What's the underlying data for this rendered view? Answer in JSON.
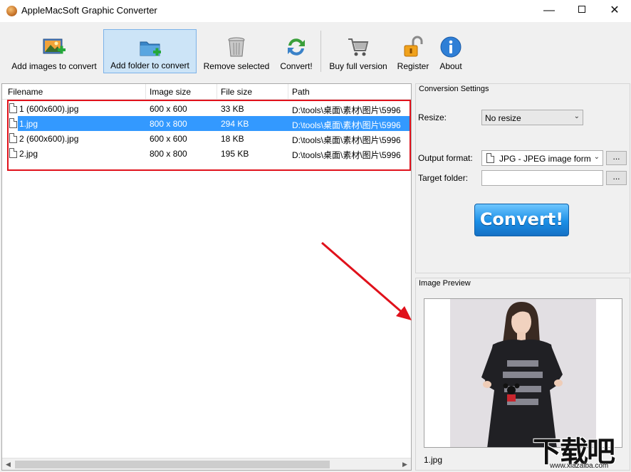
{
  "window": {
    "title": "AppleMacSoft Graphic Converter",
    "minimize": "—",
    "close": "✕"
  },
  "toolbar": {
    "buttons": [
      {
        "label": "Add images to convert",
        "icon": "add-images-icon"
      },
      {
        "label": "Add folder to convert",
        "icon": "add-folder-icon"
      },
      {
        "label": "Remove selected",
        "icon": "trash-icon"
      },
      {
        "label": "Convert!",
        "icon": "refresh-icon"
      },
      {
        "label": "Buy full version",
        "icon": "cart-icon"
      },
      {
        "label": "Register",
        "icon": "lock-icon"
      },
      {
        "label": "About",
        "icon": "info-icon"
      }
    ]
  },
  "file_list": {
    "columns": [
      "Filename",
      "Image size",
      "File size",
      "Path"
    ],
    "rows": [
      {
        "filename": "1 (600x600).jpg",
        "image_size": "600 x 600",
        "file_size": "33 KB",
        "path": "D:\\tools\\桌面\\素材\\图片\\5996",
        "selected": false
      },
      {
        "filename": "1.jpg",
        "image_size": "800 x 800",
        "file_size": "294 KB",
        "path": "D:\\tools\\桌面\\素材\\图片\\5996",
        "selected": true
      },
      {
        "filename": "2 (600x600).jpg",
        "image_size": "600 x 600",
        "file_size": "18 KB",
        "path": "D:\\tools\\桌面\\素材\\图片\\5996",
        "selected": false
      },
      {
        "filename": "2.jpg",
        "image_size": "800 x 800",
        "file_size": "195 KB",
        "path": "D:\\tools\\桌面\\素材\\图片\\5996",
        "selected": false
      }
    ]
  },
  "settings": {
    "group_title": "Conversion Settings",
    "resize_label": "Resize:",
    "resize_value": "No resize",
    "output_format_label": "Output format:",
    "output_format_value": "JPG - JPEG image form",
    "target_folder_label": "Target folder:",
    "target_folder_value": "",
    "browse": "...",
    "convert_label": "Convert!"
  },
  "preview": {
    "group_title": "Image Preview",
    "filename": "1.jpg"
  },
  "watermark": {
    "big": "下载吧",
    "small": "www.xiazaiba.com"
  },
  "colors": {
    "selection": "#3399ff",
    "annotation_red": "#e0111b",
    "convert_blue": "#1b8fe6"
  }
}
